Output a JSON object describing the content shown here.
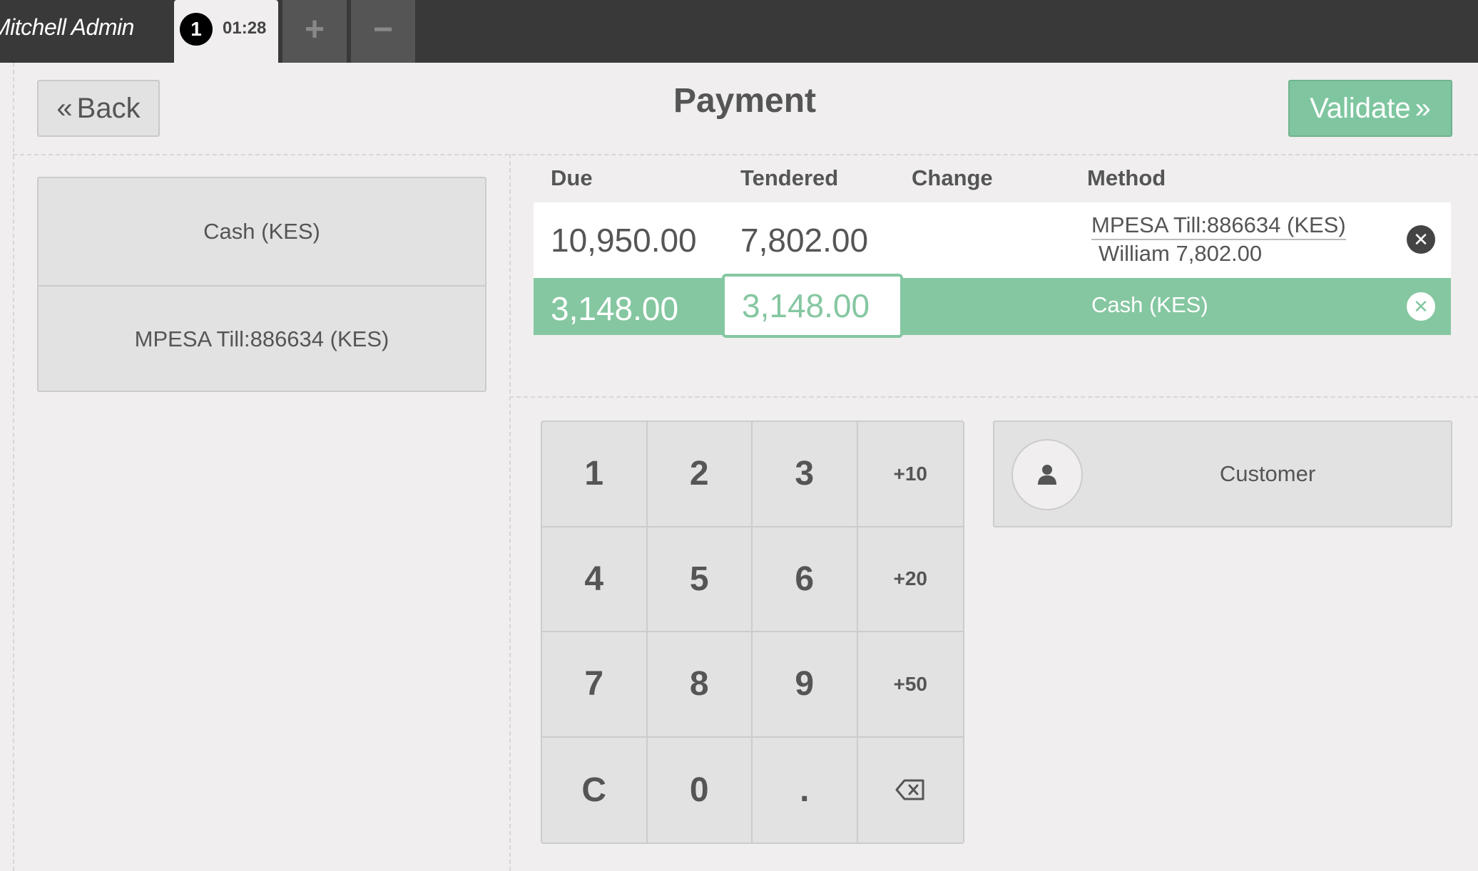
{
  "topbar": {
    "user_name": "Mitchell Admin",
    "order_sequence": "1",
    "order_time": "01:28",
    "add_order_label": "+",
    "remove_order_label": "−"
  },
  "header": {
    "back_label": "Back",
    "title": "Payment",
    "validate_label": "Validate"
  },
  "payment_methods": [
    "Cash (KES)",
    "MPESA Till:886634 (KES)"
  ],
  "paymentlines": {
    "columns": [
      "Due",
      "Tendered",
      "Change",
      "Method"
    ],
    "rows": [
      {
        "due": "10,950.00",
        "tendered": "7,802.00",
        "change": "",
        "method": "MPESA Till:886634 (KES)",
        "method_sub": "William  7,802.00",
        "selected": false
      },
      {
        "due": "3,148.00",
        "tendered": "3,148.00",
        "change": "",
        "method": "Cash (KES)",
        "method_sub": "",
        "selected": true
      }
    ]
  },
  "numpad": {
    "keys": [
      "1",
      "2",
      "3",
      "+10",
      "4",
      "5",
      "6",
      "+20",
      "7",
      "8",
      "9",
      "+50",
      "C",
      "0",
      ".",
      "⌫"
    ]
  },
  "customer": {
    "label": "Customer"
  },
  "colors": {
    "accent": "#7fc6a0",
    "topbar": "#393939",
    "background": "#f0eeee"
  }
}
